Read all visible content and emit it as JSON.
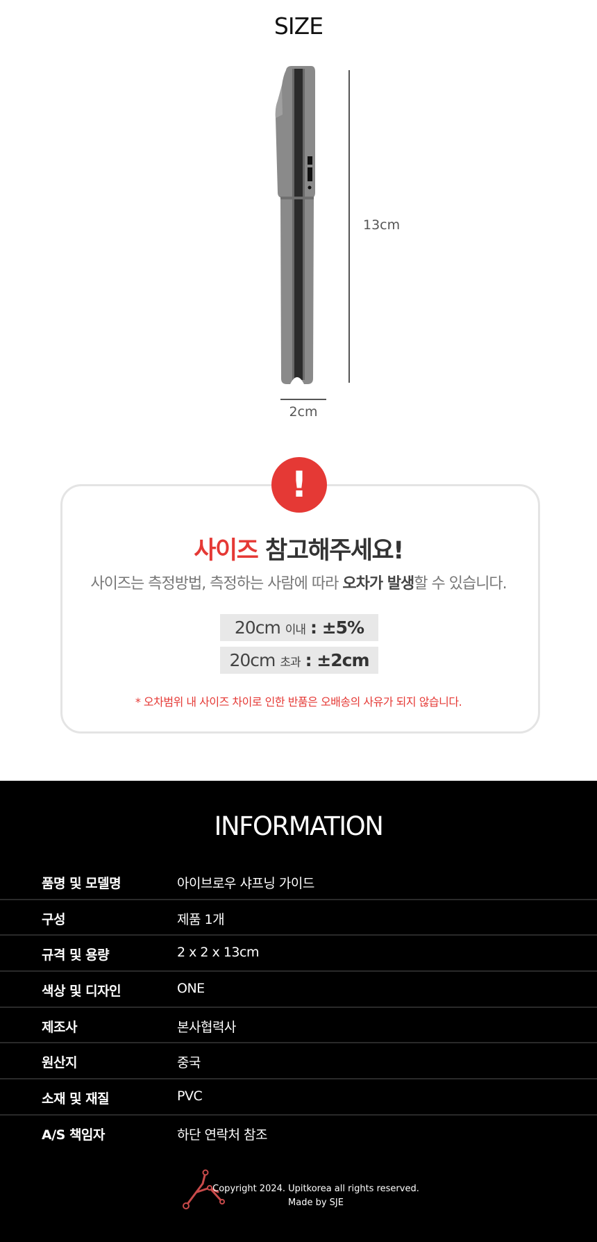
{
  "size": {
    "title": "SIZE",
    "height_label": "13cm",
    "width_label": "2cm"
  },
  "warning": {
    "badge": "!",
    "heading_accent": "사이즈",
    "heading_rest": " 참고해주세요!",
    "desc_prefix": "사이즈는 측정방법, 측정하는 사람에 따라 ",
    "desc_bold": "오차가 발생",
    "desc_suffix": "할 수 있습니다.",
    "tolerance": [
      {
        "size": "20cm",
        "qualifier": "이내",
        "value": ": ±5%"
      },
      {
        "size": "20cm",
        "qualifier": "초과",
        "value": ": ±2cm"
      }
    ],
    "note": "* 오차범위 내 사이즈 차이로 인한 반품은 오배송의 사유가 되지 않습니다."
  },
  "info": {
    "title": "INFORMATION",
    "rows": [
      {
        "key": "품명 및 모델명",
        "value": "아이브로우 샤프닝 가이드"
      },
      {
        "key": "구성",
        "value": "제품 1개"
      },
      {
        "key": "규격 및 용량",
        "value": "2 x 2 x 13cm"
      },
      {
        "key": "색상 및 디자인",
        "value": "ONE"
      },
      {
        "key": "제조사",
        "value": "본사협력사"
      },
      {
        "key": "원산지",
        "value": "중국"
      },
      {
        "key": "소재 및 재질",
        "value": "PVC"
      },
      {
        "key": "A/S 책임자",
        "value": "하단 연락처 참조"
      }
    ]
  },
  "footer": {
    "copyright": "Copyright 2024. Upitkorea all rights reserved.",
    "made_by": "Made by SJE"
  },
  "colors": {
    "accent": "#e53935",
    "product_gray": "#8a8a8a",
    "info_bg": "#000000"
  }
}
